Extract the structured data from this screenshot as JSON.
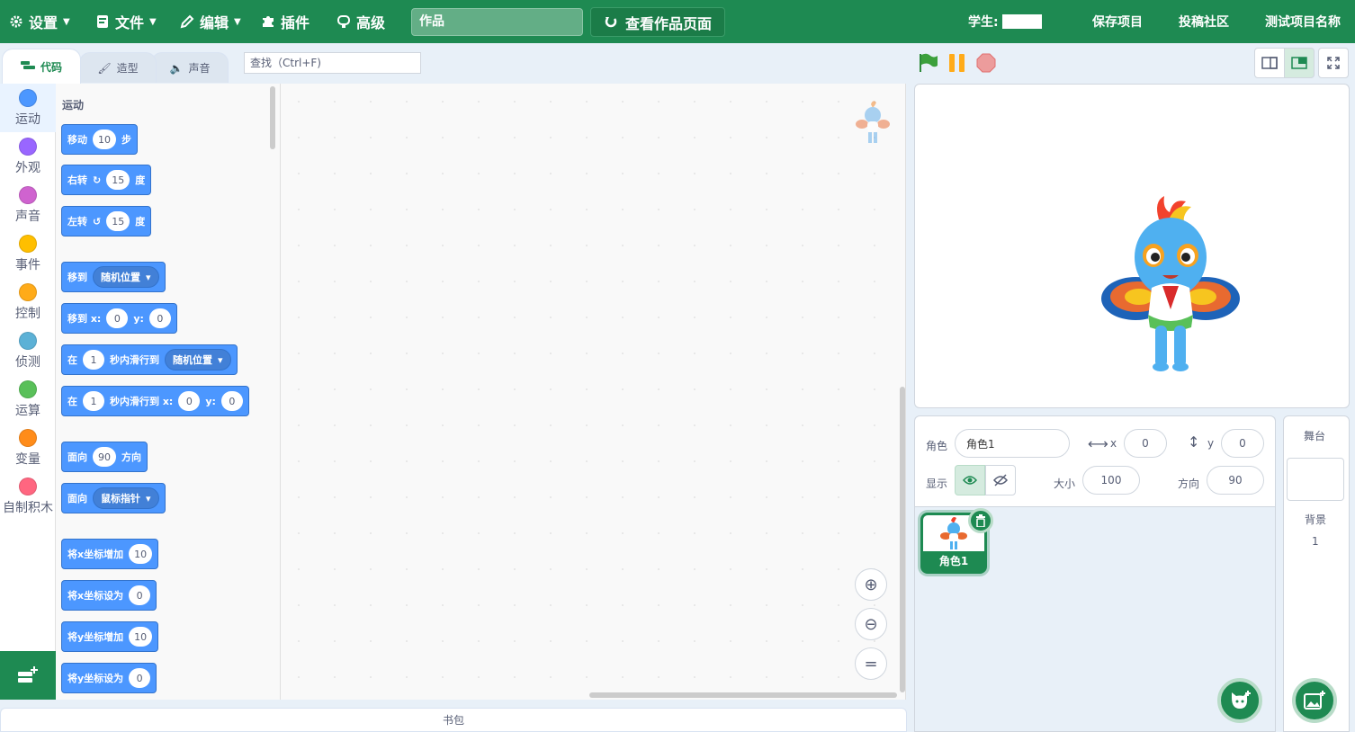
{
  "menu": {
    "settings": "设置",
    "file": "文件",
    "edit": "编辑",
    "plugins": "插件",
    "advanced": "高级",
    "project_title": "作品",
    "see_project_page": "查看作品页面",
    "student_label": "学生:",
    "save_project": "保存项目",
    "submit_community": "投稿社区",
    "test_project_name": "测试项目名称"
  },
  "tabs": {
    "code": "代码",
    "costumes": "造型",
    "sounds": "声音"
  },
  "search": {
    "placeholder": "查找（Ctrl+F)"
  },
  "categories": [
    {
      "label": "运动",
      "color": "#4c97ff"
    },
    {
      "label": "外观",
      "color": "#9966ff"
    },
    {
      "label": "声音",
      "color": "#cf63cf"
    },
    {
      "label": "事件",
      "color": "#ffbf00"
    },
    {
      "label": "控制",
      "color": "#ffab19"
    },
    {
      "label": "侦测",
      "color": "#5cb1d6"
    },
    {
      "label": "运算",
      "color": "#59c059"
    },
    {
      "label": "变量",
      "color": "#ff8c1a"
    },
    {
      "label": "自制积木",
      "color": "#ff6680"
    }
  ],
  "palette": {
    "title": "运动",
    "move": {
      "a": "移动",
      "v": "10",
      "b": "步"
    },
    "turn_right": {
      "a": "右转",
      "v": "15",
      "b": "度"
    },
    "turn_left": {
      "a": "左转",
      "v": "15",
      "b": "度"
    },
    "goto": {
      "a": "移到",
      "dd": "随机位置"
    },
    "goto_xy": {
      "a": "移到 x:",
      "x": "0",
      "y_label": "y:",
      "y": "0"
    },
    "glide": {
      "a": "在",
      "v": "1",
      "b": "秒内滑行到",
      "dd": "随机位置"
    },
    "glide_xy": {
      "a": "在",
      "v": "1",
      "b": "秒内滑行到 x:",
      "x": "0",
      "y_label": "y:",
      "y": "0"
    },
    "point_dir": {
      "a": "面向",
      "v": "90",
      "b": "方向"
    },
    "point_towards": {
      "a": "面向",
      "dd": "鼠标指针"
    },
    "change_x": {
      "a": "将x坐标增加",
      "v": "10"
    },
    "set_x": {
      "a": "将x坐标设为",
      "v": "0"
    },
    "change_y": {
      "a": "将y坐标增加",
      "v": "10"
    },
    "set_y": {
      "a": "将y坐标设为",
      "v": "0"
    }
  },
  "backpack": "书包",
  "sprite_info": {
    "sprite_label": "角色",
    "sprite_name": "角色1",
    "x_label": "x",
    "x": "0",
    "y_label": "y",
    "y": "0",
    "show_label": "显示",
    "size_label": "大小",
    "size": "100",
    "direction_label": "方向",
    "direction": "90"
  },
  "sprites": [
    {
      "name": "角色1"
    }
  ],
  "stage_pane": {
    "title": "舞台",
    "backdrop_label": "背景",
    "backdrop_count": "1"
  },
  "colors": {
    "brand": "#1e8a52",
    "motion": "#4c97ff"
  }
}
